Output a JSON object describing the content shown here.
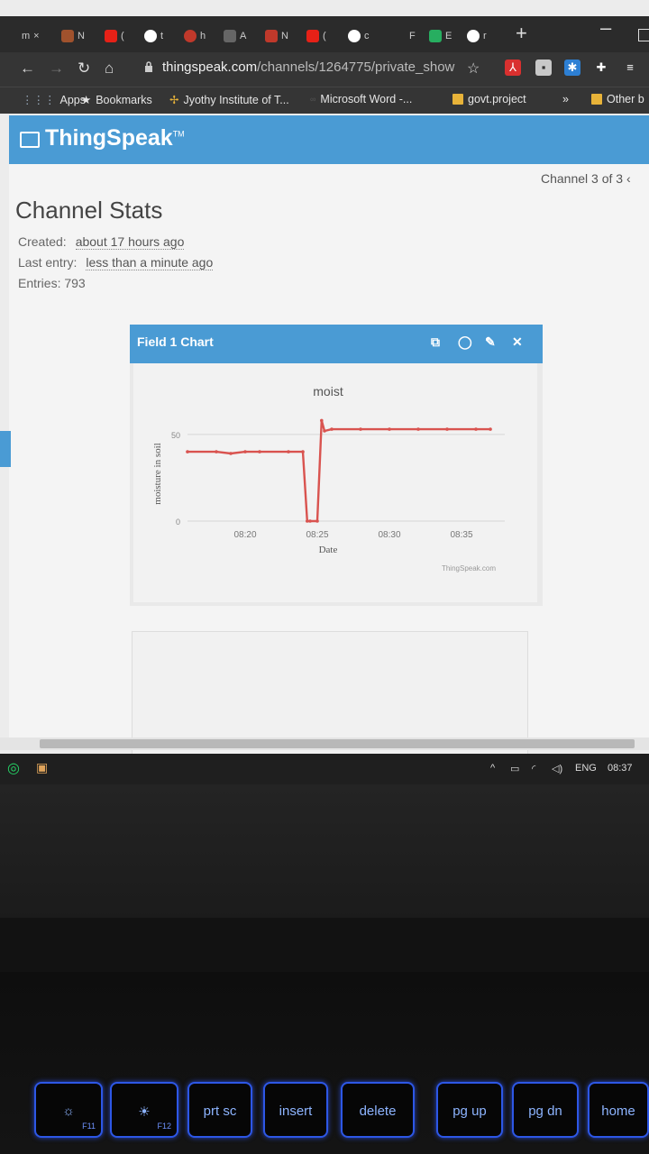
{
  "browser": {
    "tabs": [
      {
        "label": "m",
        "color": "#888"
      },
      {
        "label": "N",
        "color": "#a0522d"
      },
      {
        "label": "(",
        "color": "#e62117"
      },
      {
        "label": "t",
        "color": "#ffffff"
      },
      {
        "label": "h",
        "color": "#c0392b"
      },
      {
        "label": "A",
        "color": "#777"
      },
      {
        "label": "N",
        "color": "#c0392b"
      },
      {
        "label": "(",
        "color": "#e62117"
      },
      {
        "label": "c",
        "color": "#ffffff"
      },
      {
        "label": "F",
        "color": "#555"
      },
      {
        "label": "E",
        "color": "#27ae60"
      },
      {
        "label": "r",
        "color": "#ffffff"
      }
    ],
    "tab_close": "×",
    "new_tab": "+",
    "url_host": "thingspeak.com",
    "url_path": "/channels/1264775/private_show"
  },
  "bookmarks": {
    "apps": "Apps",
    "bookmarks": "Bookmarks",
    "jyothy": "Jyothy Institute of T...",
    "word": "Microsoft Word -...",
    "govt": "govt.project",
    "more": "»",
    "other": "Other b"
  },
  "header": {
    "logo": "ThingSpeak",
    "tm": "TM"
  },
  "page": {
    "channel_nav": "Channel 3 of 3 ‹",
    "stats_title": "Channel Stats",
    "created_label": "Created:",
    "created_value": "about 17 hours ago",
    "last_entry_label": "Last entry:",
    "last_entry_value": "less than a minute ago",
    "entries": "Entries: 793"
  },
  "widget": {
    "title": "Field 1 Chart",
    "icons": [
      "external-link-icon",
      "comment-icon",
      "pencil-icon",
      "close-icon"
    ]
  },
  "chart_data": {
    "type": "line",
    "title": "moist",
    "xlabel": "Date",
    "ylabel": "moisture in soil",
    "credit": "ThingSpeak.com",
    "x_ticks": [
      "08:20",
      "08:25",
      "08:30",
      "08:35"
    ],
    "y_ticks": [
      0,
      50
    ],
    "ylim": [
      0,
      65
    ],
    "xlim": [
      "08:16",
      "08:38"
    ],
    "color": "#d9534f",
    "grid": true,
    "series": [
      {
        "x": [
          "08:16",
          "08:18",
          "08:19",
          "08:20",
          "08:21",
          "08:23",
          "08:24",
          "08:24.3",
          "08:24.5",
          "08:25",
          "08:25.3",
          "08:25.5",
          "08:26",
          "08:28",
          "08:30",
          "08:32",
          "08:34",
          "08:36",
          "08:37"
        ],
        "y": [
          40,
          40,
          39,
          40,
          40,
          40,
          40,
          0,
          0,
          0,
          58,
          52,
          53,
          53,
          53,
          53,
          53,
          53,
          53
        ]
      }
    ]
  },
  "taskbar": {
    "lang": "ENG",
    "time": "08:37",
    "tray_arrow": "^"
  },
  "keyboard": {
    "keys": [
      {
        "label": "☼",
        "sub": "F11"
      },
      {
        "label": "☀",
        "sub": "F12"
      },
      {
        "label": "prt sc",
        "sub": ""
      },
      {
        "label": "insert",
        "sub": ""
      },
      {
        "label": "delete",
        "sub": ""
      },
      {
        "label": "pg up",
        "sub": ""
      },
      {
        "label": "pg dn",
        "sub": ""
      },
      {
        "label": "home",
        "sub": ""
      }
    ]
  }
}
